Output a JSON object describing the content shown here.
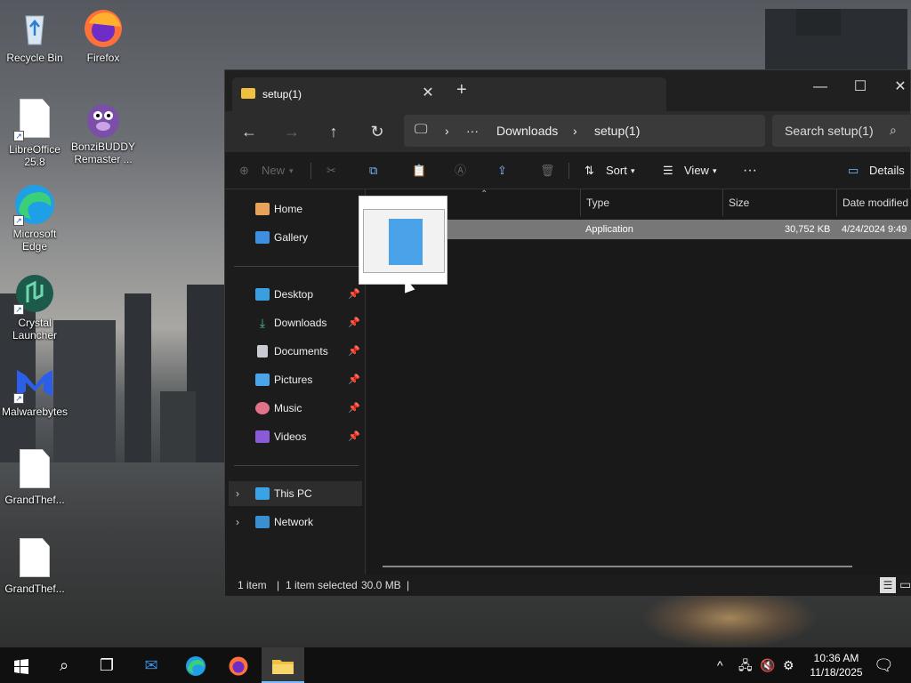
{
  "desktop": {
    "icons": [
      {
        "label": "Recycle Bin"
      },
      {
        "label": "Firefox"
      },
      {
        "label": "LibreOffice 25.8"
      },
      {
        "label": "BonziBUDDY Remaster ..."
      },
      {
        "label": "Microsoft Edge"
      },
      {
        "label": "Crystal Launcher"
      },
      {
        "label": "Malwarebytes"
      },
      {
        "label": "GrandThef..."
      },
      {
        "label": "GrandThef..."
      }
    ]
  },
  "window": {
    "tab_title": "setup(1)",
    "tab_close": "✕",
    "new_tab": "+",
    "minimize": "—",
    "maximize": "☐",
    "close": "✕"
  },
  "navbar": {
    "back": "←",
    "forward": "→",
    "up": "↑",
    "refresh": "↻",
    "breadcrumb": [
      "Downloads",
      "setup(1)"
    ],
    "ellipsis": "···",
    "search_placeholder": "Search setup(1)"
  },
  "toolbar": {
    "new_label": "New",
    "sort_label": "Sort",
    "view_label": "View",
    "more_label": "···",
    "details_label": "Details"
  },
  "sidebar": {
    "items": [
      {
        "label": "Home"
      },
      {
        "label": "Gallery"
      },
      {
        "label": "Desktop"
      },
      {
        "label": "Downloads"
      },
      {
        "label": "Documents"
      },
      {
        "label": "Pictures"
      },
      {
        "label": "Music"
      },
      {
        "label": "Videos"
      },
      {
        "label": "This PC"
      },
      {
        "label": "Network"
      }
    ]
  },
  "content": {
    "columns": [
      "Type",
      "Size",
      "Date modified"
    ],
    "rows": [
      {
        "type": "Application",
        "size": "30,752 KB",
        "date": "4/24/2024 9:49"
      }
    ]
  },
  "statusbar": {
    "count": "1 item",
    "selected": "1 item selected",
    "size": "30.0 MB"
  },
  "taskbar": {
    "time": "10:36 AM",
    "date": "11/18/2025"
  },
  "colors": {
    "accent": "#7ab8ff",
    "window_bg": "#1c1c1c",
    "selected_row": "#777777"
  }
}
